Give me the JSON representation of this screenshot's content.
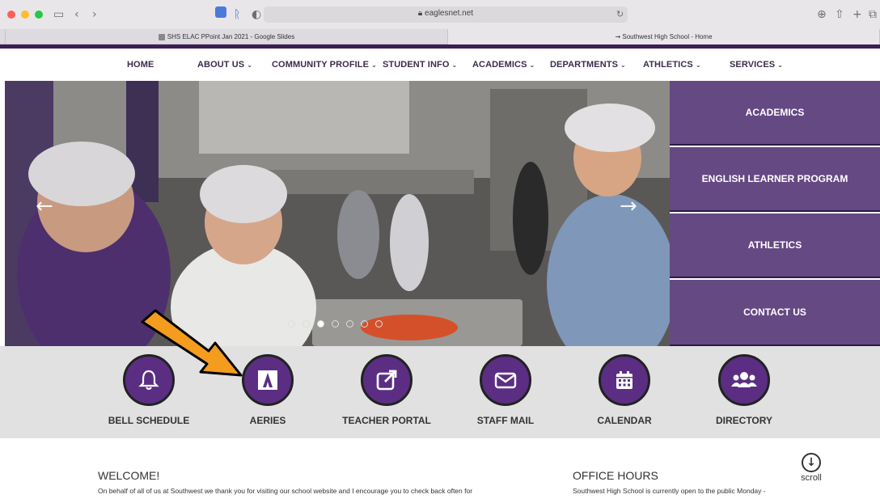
{
  "browser": {
    "address": "eaglesnet.net",
    "tabs": [
      {
        "label": "SHS ELAC PPoint Jan 2021 - Google Slides"
      },
      {
        "label": "Southwest High School - Home"
      }
    ]
  },
  "nav": {
    "items": [
      {
        "label": "HOME"
      },
      {
        "label": "ABOUT US"
      },
      {
        "label": "COMMUNITY PROFILE"
      },
      {
        "label": "STUDENT INFO"
      },
      {
        "label": "ACADEMICS"
      },
      {
        "label": "DEPARTMENTS"
      },
      {
        "label": "ATHLETICS"
      },
      {
        "label": "SERVICES"
      }
    ]
  },
  "hero": {
    "side_links": [
      {
        "label": "ACADEMICS"
      },
      {
        "label": "ENGLISH LEARNER PROGRAM"
      },
      {
        "label": "ATHLETICS"
      },
      {
        "label": "CONTACT US"
      }
    ]
  },
  "quick_links": [
    {
      "label": "BELL SCHEDULE",
      "icon": "bell-icon"
    },
    {
      "label": "AERIES",
      "icon": "aeries-logo-icon"
    },
    {
      "label": "TEACHER PORTAL",
      "icon": "external-link-icon"
    },
    {
      "label": "STAFF MAIL",
      "icon": "envelope-icon"
    },
    {
      "label": "CALENDAR",
      "icon": "calendar-icon"
    },
    {
      "label": "DIRECTORY",
      "icon": "users-icon"
    }
  ],
  "welcome": {
    "heading": "WELCOME!",
    "text": "On behalf of all of us at Southwest we thank you for visiting our school website and I encourage you to check back often for"
  },
  "office_hours": {
    "heading": "OFFICE HOURS",
    "text": "Southwest High School is currently open to the public Monday -"
  },
  "scroll_label": "scroll",
  "colors": {
    "brand_purple": "#5b2e83",
    "nav_text": "#3c2c4d",
    "annotation_arrow": "#f39c1e"
  }
}
